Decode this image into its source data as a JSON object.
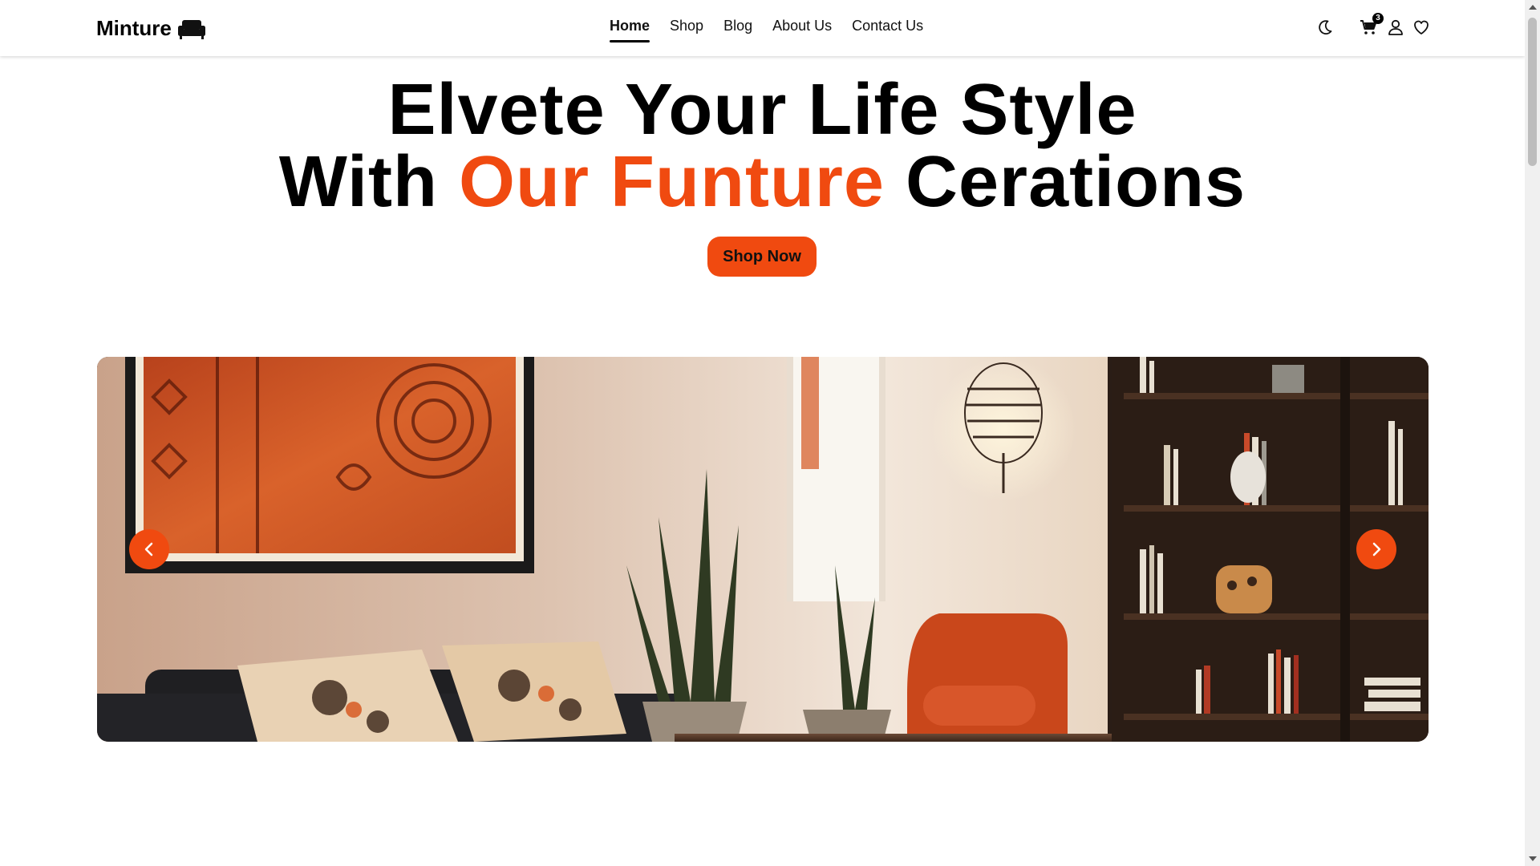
{
  "brand": {
    "name": "Minture",
    "icon": "sofa-icon"
  },
  "nav": {
    "links": [
      {
        "label": "Home",
        "active": true
      },
      {
        "label": "Shop",
        "active": false
      },
      {
        "label": "Blog",
        "active": false
      },
      {
        "label": "About Us",
        "active": false
      },
      {
        "label": "Contact Us",
        "active": false
      }
    ],
    "icons": {
      "theme": "moon-icon",
      "cart": "cart-icon",
      "user": "user-icon",
      "wishlist": "heart-icon"
    },
    "cart_count": "3"
  },
  "hero": {
    "line1": "Elvete Your Life Style",
    "line2_prefix": "With ",
    "line2_accent": "Our Funture",
    "line2_suffix": " Cerations",
    "cta_label": "Shop Now"
  },
  "carousel": {
    "prev_icon": "chevron-left-icon",
    "next_icon": "chevron-right-icon"
  },
  "colors": {
    "accent": "#f04a10",
    "text": "#000000",
    "background": "#ffffff"
  }
}
